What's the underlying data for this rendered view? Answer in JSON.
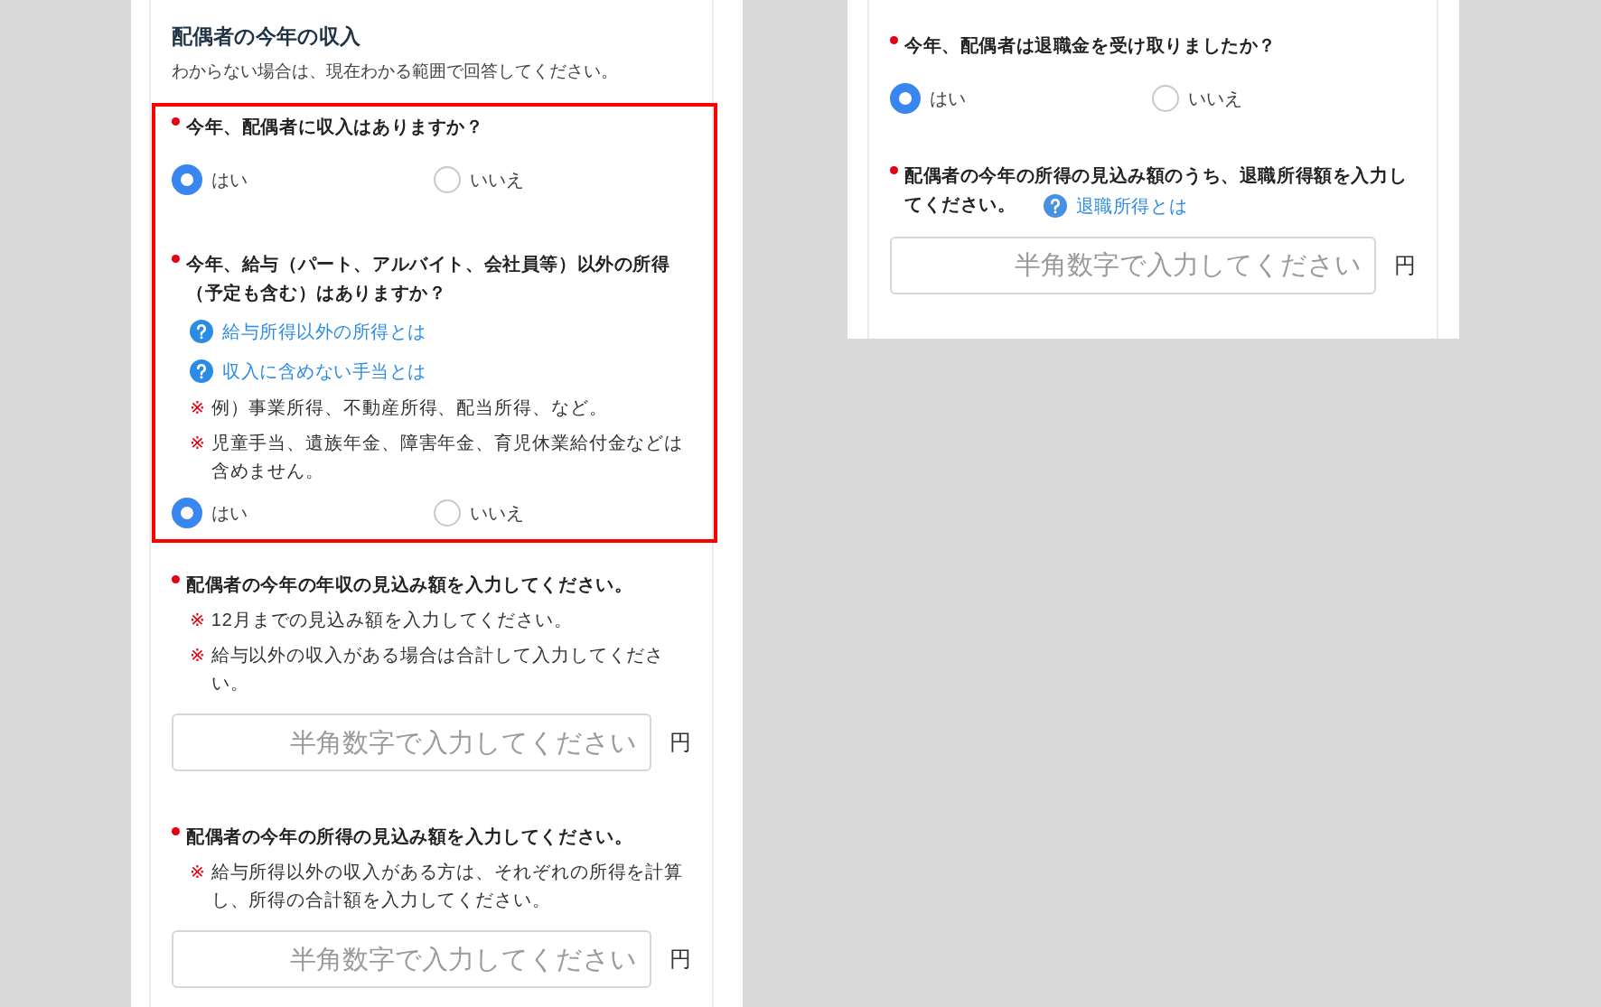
{
  "left_panel": {
    "title": "配偶者の今年の収入",
    "description": "わからない場合は、現在わかる範囲で回答してください。",
    "sections": [
      {
        "highlighted": true,
        "questions": [
          {
            "kind": "radio",
            "required": true,
            "label": "今年、配偶者に収入はありますか？",
            "options": [
              {
                "label": "はい",
                "selected": true
              },
              {
                "label": "いいえ",
                "selected": false
              }
            ]
          },
          {
            "kind": "radio",
            "required": true,
            "label": "今年、給与（パート、アルバイト、会社員等）以外の所得（予定も含む）はありますか？",
            "help_links": [
              {
                "kind": "block",
                "label": "給与所得以外の所得とは"
              },
              {
                "kind": "block",
                "label": "収入に含めない手当とは"
              }
            ],
            "notes": [
              {
                "mark": "※",
                "text": "例）事業所得、不動産所得、配当所得、など。"
              },
              {
                "mark": "※",
                "text": "児童手当、遺族年金、障害年金、育児休業給付金などは含めません。"
              }
            ],
            "options": [
              {
                "label": "はい",
                "selected": true
              },
              {
                "label": "いいえ",
                "selected": false
              }
            ]
          }
        ]
      },
      {
        "highlighted": false,
        "questions": [
          {
            "kind": "amount",
            "required": true,
            "label": "配偶者の今年の年収の見込み額を入力してください。",
            "notes": [
              {
                "mark": "※",
                "text": "12月までの見込み額を入力してください。"
              },
              {
                "mark": "※",
                "text": "給与以外の収入がある場合は合計して入力してください。"
              }
            ],
            "placeholder": "半角数字で入力してください",
            "unit": "円"
          },
          {
            "kind": "amount",
            "required": true,
            "label": "配偶者の今年の所得の見込み額を入力してください。",
            "notes": [
              {
                "mark": "※",
                "text": "給与所得以外の収入がある方は、それぞれの所得を計算し、所得の合計額を入力してください。"
              }
            ],
            "placeholder": "半角数字で入力してください",
            "unit": "円"
          }
        ]
      }
    ]
  },
  "right_panel": {
    "questions": [
      {
        "kind": "radio",
        "required": true,
        "label": "今年、配偶者は退職金を受け取りましたか？",
        "options": [
          {
            "label": "はい",
            "selected": true
          },
          {
            "label": "いいえ",
            "selected": false
          }
        ]
      },
      {
        "kind": "amount",
        "required": true,
        "label": "配偶者の今年の所得の見込み額のうち、退職所得額を入力してください。",
        "help_links": [
          {
            "kind": "inline",
            "label": "退職所得とは"
          }
        ],
        "placeholder": "半角数字で入力してください",
        "unit": "円"
      }
    ]
  }
}
